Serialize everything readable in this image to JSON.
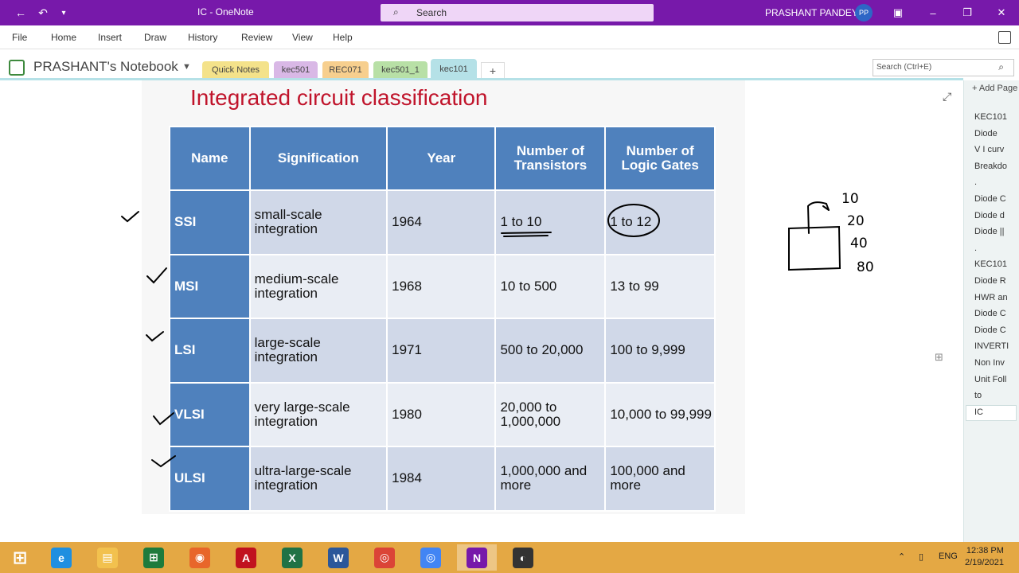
{
  "window": {
    "title": "IC  -  OneNote",
    "search_placeholder": "Search",
    "user_name": "PRASHANT PANDEY",
    "user_initials": "PP"
  },
  "menu": [
    "File",
    "Home",
    "Insert",
    "Draw",
    "History",
    "Review",
    "View",
    "Help"
  ],
  "notebook": {
    "name": "PRASHANT's Notebook",
    "sections": [
      {
        "label": "Quick Notes",
        "color": "#f4e28a"
      },
      {
        "label": "kec501",
        "color": "#d9b8e6"
      },
      {
        "label": "REC071",
        "color": "#f7cf8e"
      },
      {
        "label": "kec501_1",
        "color": "#b8e0a6"
      },
      {
        "label": "kec101",
        "color": "#b5e1e7"
      }
    ],
    "search_placeholder": "Search (Ctrl+E)"
  },
  "page": {
    "title": "Integrated circuit classification",
    "table": {
      "headers": [
        "Name",
        "Signification",
        "Year",
        "Number of Transistors",
        "Number of Logic Gates"
      ],
      "rows": [
        [
          "SSI",
          "small-scale integration",
          "1964",
          "1 to 10",
          "1 to 12"
        ],
        [
          "MSI",
          "medium-scale integration",
          "1968",
          "10 to 500",
          "13 to 99"
        ],
        [
          "LSI",
          "large-scale integration",
          "1971",
          "500 to 20,000",
          "100 to 9,999"
        ],
        [
          "VLSI",
          "very large-scale integration",
          "1980",
          "20,000 to 1,000,000",
          "10,000 to 99,999"
        ],
        [
          "ULSI",
          "ultra-large-scale integration",
          "1984",
          "1,000,000 and more",
          "100,000 and more"
        ]
      ]
    },
    "handwriting": [
      "10",
      "20",
      "40",
      "80"
    ]
  },
  "pages_panel": {
    "add_label": "Add Page",
    "items": [
      "KEC101",
      "Diode",
      "V I curv",
      "Breakdo",
      ".",
      "Diode C",
      "Diode d",
      "Diode ||",
      ".",
      "KEC101",
      "Diode R",
      "HWR an",
      "Diode C",
      "Diode C",
      "INVERTI",
      "Non Inv",
      "Unit Foll",
      "to",
      "IC"
    ]
  },
  "taskbar": {
    "language": "ENG",
    "time": "12:38 PM",
    "date": "2/19/2021",
    "apps": [
      {
        "name": "internet-explorer",
        "color": "#1f8fe0",
        "glyph": "e"
      },
      {
        "name": "file-explorer",
        "color": "#f2c14e",
        "glyph": "▤"
      },
      {
        "name": "excel-green",
        "color": "#1e7b3c",
        "glyph": "⊞"
      },
      {
        "name": "firefox",
        "color": "#e8662a",
        "glyph": "◉"
      },
      {
        "name": "acrobat",
        "color": "#c1121f",
        "glyph": "A"
      },
      {
        "name": "excel",
        "color": "#207245",
        "glyph": "X"
      },
      {
        "name": "word",
        "color": "#2b579a",
        "glyph": "W"
      },
      {
        "name": "chrome",
        "color": "#db4437",
        "glyph": "◎"
      },
      {
        "name": "chrome-blue",
        "color": "#4285f4",
        "glyph": "◎"
      },
      {
        "name": "onenote",
        "color": "#7719aa",
        "glyph": "N"
      },
      {
        "name": "obs",
        "color": "#333333",
        "glyph": "◐"
      }
    ]
  }
}
